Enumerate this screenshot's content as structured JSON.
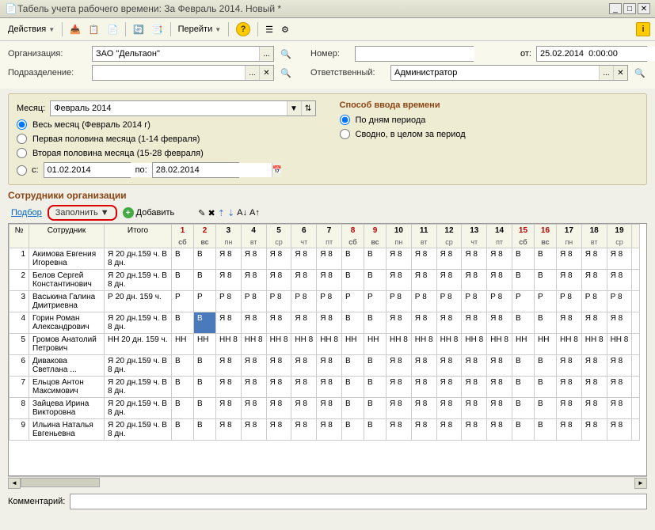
{
  "window": {
    "title": "Табель учета рабочего времени: За Февраль 2014. Новый *"
  },
  "toolbar": {
    "actions": "Действия",
    "goto": "Перейти"
  },
  "form": {
    "org_label": "Организация:",
    "org_value": "ЗАО \"Дельтаон\"",
    "dept_label": "Подразделение:",
    "dept_value": "",
    "number_label": "Номер:",
    "number_value": "",
    "from_label": "от:",
    "from_value": "25.02.2014  0:00:00",
    "resp_label": "Ответственный:",
    "resp_value": "Администратор"
  },
  "params": {
    "month_label": "Месяц:",
    "month_value": "Февраль 2014",
    "r_full": "Весь месяц (Февраль 2014 г)",
    "r_first": "Первая половина месяца (1-14 февраля)",
    "r_second": "Вторая половина месяца (15-28 февраля)",
    "date_from_label": "с:",
    "date_from": "01.02.2014",
    "date_to_label": "по:",
    "date_to": "28.02.2014",
    "mode_title": "Способ ввода времени",
    "mode_days": "По дням периода",
    "mode_summary": "Сводно, в целом за период"
  },
  "section_title": "Сотрудники организации",
  "toolbar2": {
    "pick": "Подбор",
    "fill": "Заполнить",
    "add": "Добавить"
  },
  "grid": {
    "col_num": "№",
    "col_emp": "Сотрудник",
    "col_total": "Итого",
    "days": [
      {
        "n": "1",
        "w": "сб",
        "we": true
      },
      {
        "n": "2",
        "w": "вс",
        "we": true
      },
      {
        "n": "3",
        "w": "пн"
      },
      {
        "n": "4",
        "w": "вт"
      },
      {
        "n": "5",
        "w": "ср"
      },
      {
        "n": "6",
        "w": "чт"
      },
      {
        "n": "7",
        "w": "пт"
      },
      {
        "n": "8",
        "w": "сб",
        "we": true
      },
      {
        "n": "9",
        "w": "вс",
        "we": true
      },
      {
        "n": "10",
        "w": "пн"
      },
      {
        "n": "11",
        "w": "вт"
      },
      {
        "n": "12",
        "w": "ср"
      },
      {
        "n": "13",
        "w": "чт"
      },
      {
        "n": "14",
        "w": "пт"
      },
      {
        "n": "15",
        "w": "сб",
        "we": true
      },
      {
        "n": "16",
        "w": "вс",
        "we": true
      },
      {
        "n": "17",
        "w": "пн"
      },
      {
        "n": "18",
        "w": "вт"
      },
      {
        "n": "19",
        "w": "ср"
      }
    ],
    "rows": [
      {
        "n": 1,
        "emp": "Акимова Евгения Игоревна",
        "total": "Я 20 дн.159 ч. В 8 дн.",
        "cells": [
          "В",
          "В",
          "Я 8",
          "Я 8",
          "Я 8",
          "Я 8",
          "Я 8",
          "В",
          "В",
          "Я 8",
          "Я 8",
          "Я 8",
          "Я 8",
          "Я 8",
          "В",
          "В",
          "Я 8",
          "Я 8",
          "Я 8"
        ]
      },
      {
        "n": 2,
        "emp": "Белов Сергей Константинович",
        "total": "Я 20 дн.159 ч. В 8 дн.",
        "cells": [
          "В",
          "В",
          "Я 8",
          "Я 8",
          "Я 8",
          "Я 8",
          "Я 8",
          "В",
          "В",
          "Я 8",
          "Я 8",
          "Я 8",
          "Я 8",
          "Я 8",
          "В",
          "В",
          "Я 8",
          "Я 8",
          "Я 8"
        ]
      },
      {
        "n": 3,
        "emp": "Васькина Галина Дмитриевна",
        "total": "Р 20 дн. 159 ч.",
        "cells": [
          "Р",
          "Р",
          "Р 8",
          "Р 8",
          "Р 8",
          "Р 8",
          "Р 8",
          "Р",
          "Р",
          "Р 8",
          "Р 8",
          "Р 8",
          "Р 8",
          "Р 8",
          "Р",
          "Р",
          "Р 8",
          "Р 8",
          "Р 8"
        ]
      },
      {
        "n": 4,
        "emp": "Горин Роман Александрович",
        "total": "Я 20 дн.159 ч. В 8 дн.",
        "cells": [
          "В",
          "В",
          "Я 8",
          "Я 8",
          "Я 8",
          "Я 8",
          "Я 8",
          "В",
          "В",
          "Я 8",
          "Я 8",
          "Я 8",
          "Я 8",
          "Я 8",
          "В",
          "В",
          "Я 8",
          "Я 8",
          "Я 8"
        ],
        "sel": 1
      },
      {
        "n": 5,
        "emp": "Громов Анатолий Петрович",
        "total": "НН 20 дн. 159 ч.",
        "cells": [
          "НН",
          "НН",
          "НН 8",
          "НН 8",
          "НН 8",
          "НН 8",
          "НН 8",
          "НН",
          "НН",
          "НН 8",
          "НН 8",
          "НН 8",
          "НН 8",
          "НН 8",
          "НН",
          "НН",
          "НН 8",
          "НН 8",
          "НН 8"
        ]
      },
      {
        "n": 6,
        "emp": "Дивакова Светлана ...",
        "total": "Я 20 дн.159 ч. В 8 дн.",
        "cells": [
          "В",
          "В",
          "Я 8",
          "Я 8",
          "Я 8",
          "Я 8",
          "Я 8",
          "В",
          "В",
          "Я 8",
          "Я 8",
          "Я 8",
          "Я 8",
          "Я 8",
          "В",
          "В",
          "Я 8",
          "Я 8",
          "Я 8"
        ]
      },
      {
        "n": 7,
        "emp": "Ельцов Антон Максимович",
        "total": "Я 20 дн.159 ч. В 8 дн.",
        "cells": [
          "В",
          "В",
          "Я 8",
          "Я 8",
          "Я 8",
          "Я 8",
          "Я 8",
          "В",
          "В",
          "Я 8",
          "Я 8",
          "Я 8",
          "Я 8",
          "Я 8",
          "В",
          "В",
          "Я 8",
          "Я 8",
          "Я 8"
        ]
      },
      {
        "n": 8,
        "emp": "Зайцева Ирина Викторовна",
        "total": "Я 20 дн.159 ч. В 8 дн.",
        "cells": [
          "В",
          "В",
          "Я 8",
          "Я 8",
          "Я 8",
          "Я 8",
          "Я 8",
          "В",
          "В",
          "Я 8",
          "Я 8",
          "Я 8",
          "Я 8",
          "Я 8",
          "В",
          "В",
          "Я 8",
          "Я 8",
          "Я 8"
        ]
      },
      {
        "n": 9,
        "emp": "Ильина Наталья Евгеньевна",
        "total": "Я 20 дн.159 ч. В 8 дн.",
        "cells": [
          "В",
          "В",
          "Я 8",
          "Я 8",
          "Я 8",
          "Я 8",
          "Я 8",
          "В",
          "В",
          "Я 8",
          "Я 8",
          "Я 8",
          "Я 8",
          "Я 8",
          "В",
          "В",
          "Я 8",
          "Я 8",
          "Я 8"
        ]
      }
    ]
  },
  "comment_label": "Комментарий:",
  "comment_value": ""
}
